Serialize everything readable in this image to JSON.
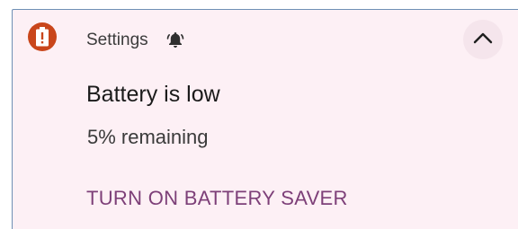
{
  "notification": {
    "app_name": "Settings",
    "app_icon": "battery-alert-icon",
    "header_icon": "bell-icon",
    "expand_icon": "chevron-up-icon",
    "title": "Battery is low",
    "text": "5% remaining",
    "action_label": "TURN ON BATTERY SAVER",
    "colors": {
      "background": "#fdf0f5",
      "app_icon_bg": "#c9461b",
      "action_text": "#7d3f78"
    }
  }
}
